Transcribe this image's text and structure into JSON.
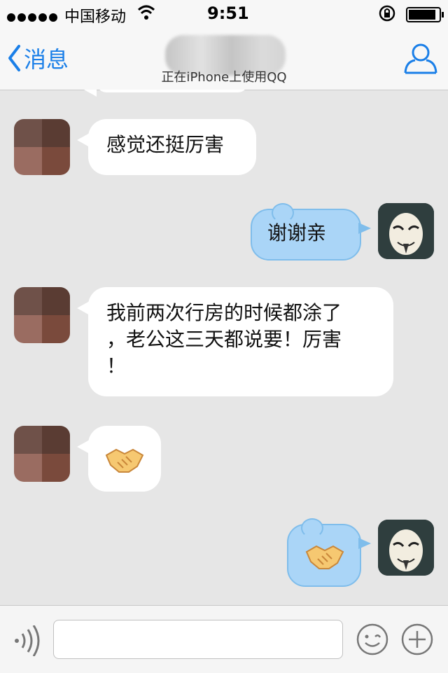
{
  "status_bar": {
    "carrier": "中国移动",
    "time": "9:51",
    "battery_level": 0.9
  },
  "nav": {
    "back_label": "消息",
    "subtitle": "正在iPhone上使用QQ"
  },
  "messages": [
    {
      "side": "left",
      "text": "感觉还挺厉害"
    },
    {
      "side": "right",
      "text": "谢谢亲"
    },
    {
      "side": "left",
      "lines": [
        "我前两次行房的时候都涂了",
        "，老公这三天都说要！厉害",
        "！"
      ]
    },
    {
      "side": "left",
      "emoji": "handshake-emoji"
    },
    {
      "side": "right",
      "emoji": "handshake-emoji"
    }
  ],
  "input": {
    "placeholder": ""
  },
  "colors": {
    "accent": "#1a7fe8",
    "self_bubble": "#aad5f7",
    "background": "#e6e6e6"
  }
}
